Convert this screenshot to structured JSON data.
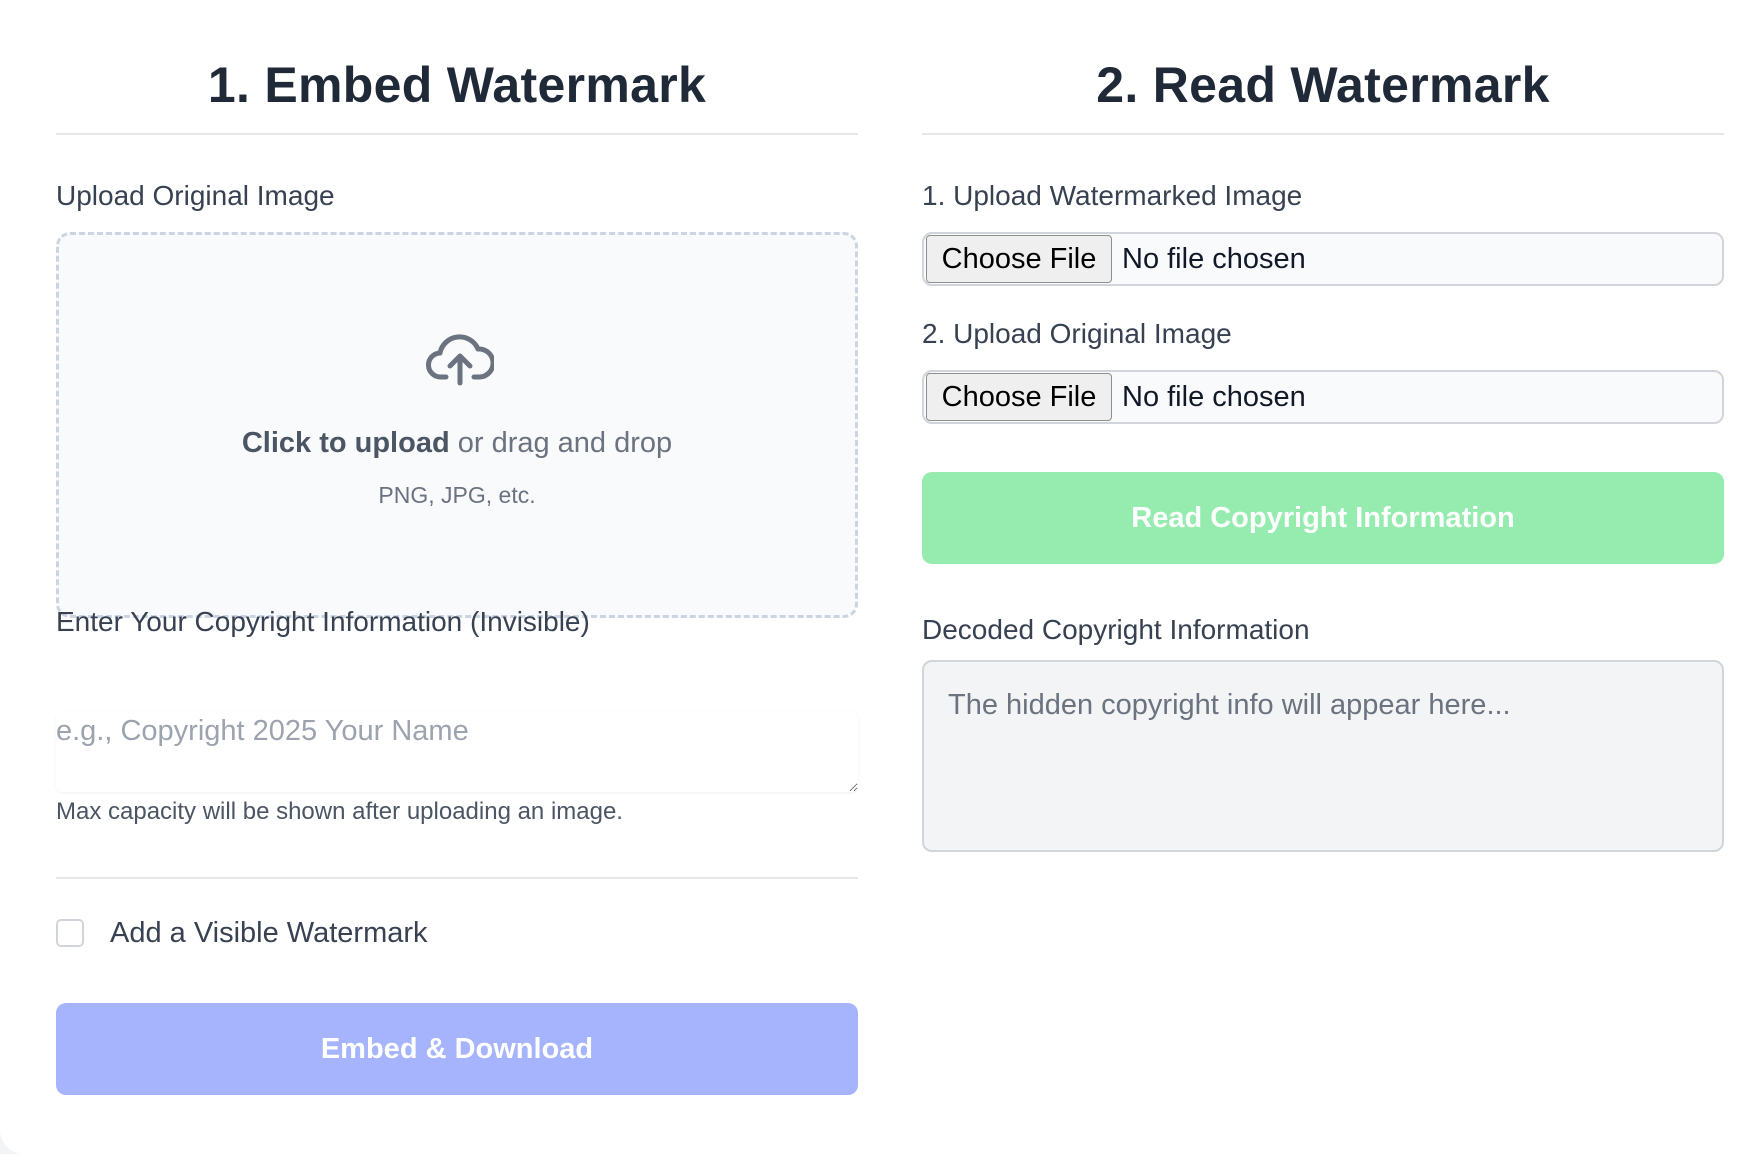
{
  "embed": {
    "title": "1. Embed Watermark",
    "upload_label": "Upload Original Image",
    "dropzone": {
      "icon": "cloud-upload-icon",
      "click_text": "Click to upload",
      "drag_text": " or drag and drop",
      "hint": "PNG, JPG, etc."
    },
    "copyright_label": "Enter Your Copyright Information (Invisible)",
    "copyright_placeholder": "e.g., Copyright 2025 Your Name",
    "copyright_value": "",
    "capacity_help": "Max capacity will be shown after uploading an image.",
    "visible_watermark_label": "Add a Visible Watermark",
    "visible_watermark_checked": false,
    "embed_button": "Embed & Download",
    "embed_button_color": "#a5b4fc"
  },
  "read": {
    "title": "2. Read Watermark",
    "watermarked_label": "1. Upload Watermarked Image",
    "watermarked_file": {
      "button": "Choose File",
      "status": "No file chosen"
    },
    "original_label": "2. Upload Original Image",
    "original_file": {
      "button": "Choose File",
      "status": "No file chosen"
    },
    "read_button": "Read Copyright Information",
    "read_button_color": "#95ecae",
    "decoded_label": "Decoded Copyright Information",
    "decoded_placeholder": "The hidden copyright info will appear here...",
    "decoded_value": ""
  }
}
